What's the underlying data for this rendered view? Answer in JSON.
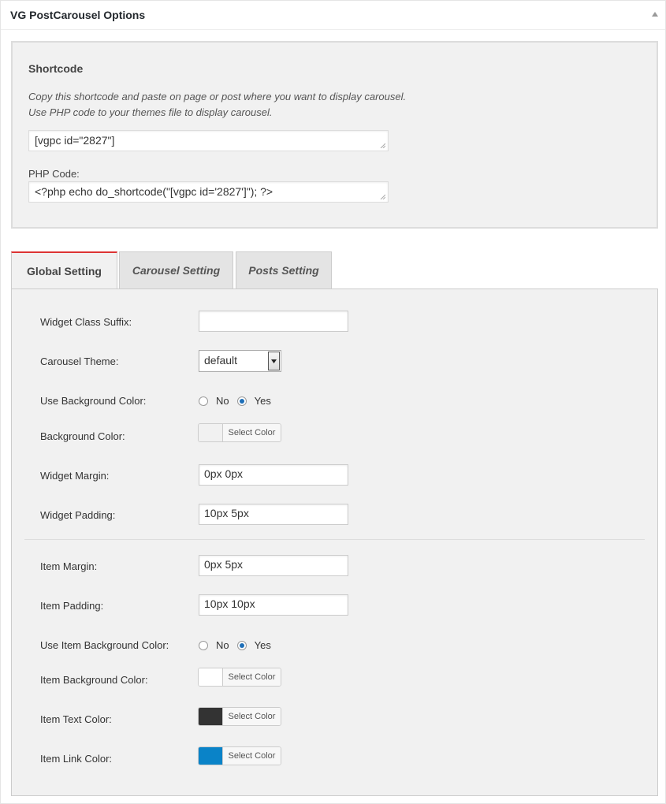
{
  "header": {
    "title": "VG PostCarousel Options",
    "toggle_icon": "triangle-up-icon"
  },
  "shortcode": {
    "heading": "Shortcode",
    "desc_line1": "Copy this shortcode and paste on page or post where you want to display carousel.",
    "desc_line2": "Use PHP code to your themes file to display carousel.",
    "shortcode_value": "[vgpc id=\"2827\"]",
    "php_label": "PHP Code:",
    "php_value": "<?php echo do_shortcode(\"[vgpc id='2827']\"); ?>"
  },
  "tabs": [
    {
      "label": "Global Setting",
      "active": true
    },
    {
      "label": "Carousel Setting",
      "active": false
    },
    {
      "label": "Posts Setting",
      "active": false
    }
  ],
  "settings": {
    "widget_class_suffix": {
      "label": "Widget Class Suffix:",
      "value": ""
    },
    "carousel_theme": {
      "label": "Carousel Theme:",
      "value": "default"
    },
    "use_bg_color": {
      "label": "Use Background Color:",
      "no": "No",
      "yes": "Yes",
      "selected": "Yes"
    },
    "bg_color": {
      "label": "Background Color:",
      "button": "Select Color",
      "color": "#f1f1f1"
    },
    "widget_margin": {
      "label": "Widget Margin:",
      "value": "0px 0px"
    },
    "widget_padding": {
      "label": "Widget Padding:",
      "value": "10px 5px"
    },
    "item_margin": {
      "label": "Item Margin:",
      "value": "0px 5px"
    },
    "item_padding": {
      "label": "Item Padding:",
      "value": "10px 10px"
    },
    "use_item_bg_color": {
      "label": "Use Item Background Color:",
      "no": "No",
      "yes": "Yes",
      "selected": "Yes"
    },
    "item_bg_color": {
      "label": "Item Background Color:",
      "button": "Select Color",
      "color": "#ffffff"
    },
    "item_text_color": {
      "label": "Item Text Color:",
      "button": "Select Color",
      "color": "#333333"
    },
    "item_link_color": {
      "label": "Item Link Color:",
      "button": "Select Color",
      "color": "#0a83c8"
    }
  },
  "colors": {
    "active_tab_accent": "#dd3333",
    "radio_checked": "#1e6fb8"
  }
}
